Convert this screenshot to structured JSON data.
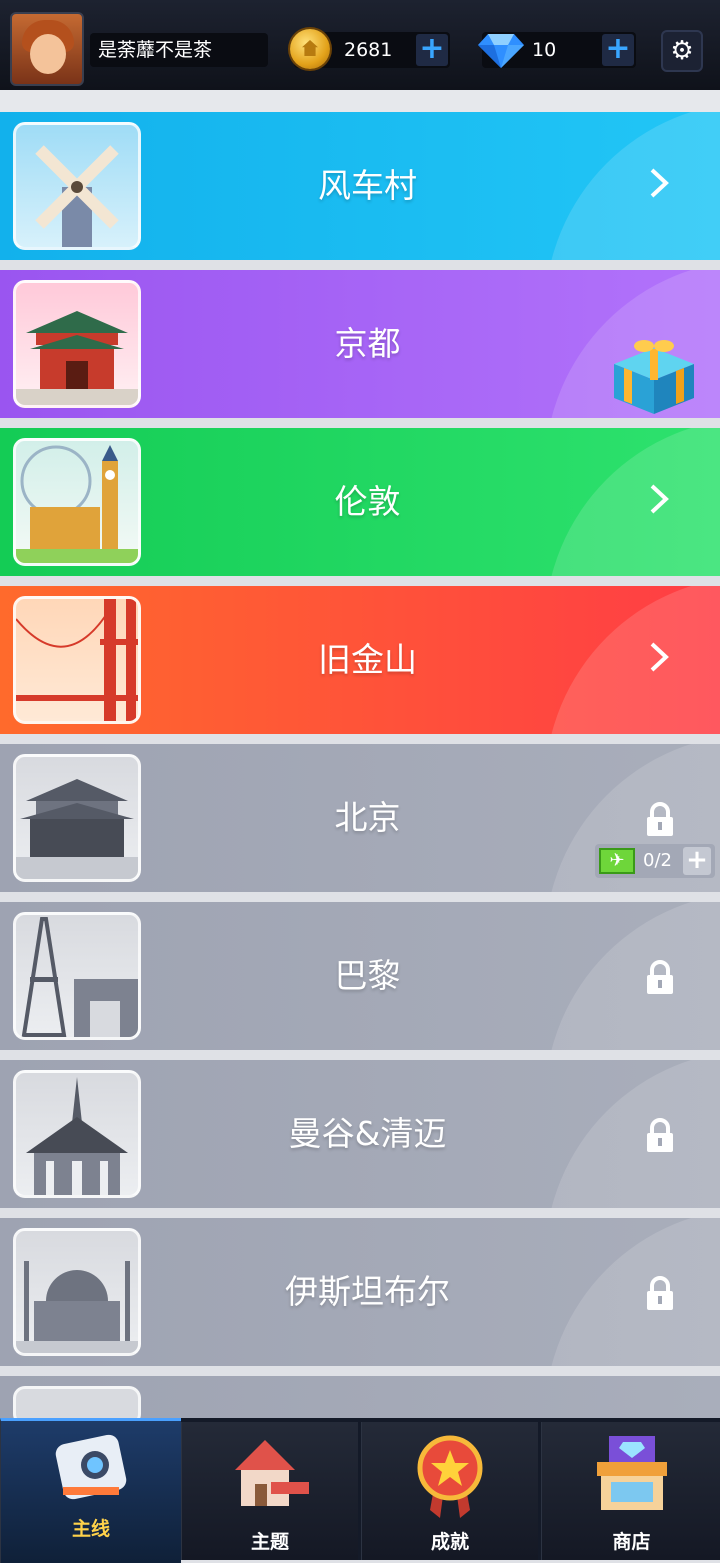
{
  "header": {
    "username": "是荼蘼不是茶",
    "coins": "2681",
    "gems": "10",
    "plus_label": "+"
  },
  "levels": [
    {
      "name": "风车村",
      "state": "unlocked",
      "color": "#18b8ef",
      "icon": "windmill-thumbnail"
    },
    {
      "name": "京都",
      "state": "unlocked",
      "color": "#a15ef5",
      "icon": "kyoto-thumbnail",
      "badge": "gift-box-icon"
    },
    {
      "name": "伦敦",
      "state": "unlocked",
      "color": "#1fd05f",
      "icon": "london-thumbnail"
    },
    {
      "name": "旧金山",
      "state": "unlocked",
      "color": "#ff5a3c",
      "icon": "san-francisco-thumbnail"
    },
    {
      "name": "北京",
      "state": "locked",
      "color": "#a3a8b6",
      "icon": "beijing-thumbnail",
      "unlock_progress": "0/2"
    },
    {
      "name": "巴黎",
      "state": "locked",
      "color": "#a3a8b6",
      "icon": "paris-thumbnail"
    },
    {
      "name": "曼谷&清迈",
      "state": "locked",
      "color": "#a3a8b6",
      "icon": "bangkok-thumbnail"
    },
    {
      "name": "伊斯坦布尔",
      "state": "locked",
      "color": "#a3a8b6",
      "icon": "istanbul-thumbnail"
    }
  ],
  "nav": {
    "items": [
      {
        "label": "主线",
        "icon": "camera-icon",
        "active": true
      },
      {
        "label": "主题",
        "icon": "house-icon",
        "active": false
      },
      {
        "label": "成就",
        "icon": "star-medal-icon",
        "active": false
      },
      {
        "label": "商店",
        "icon": "shop-icon",
        "active": false
      }
    ]
  }
}
